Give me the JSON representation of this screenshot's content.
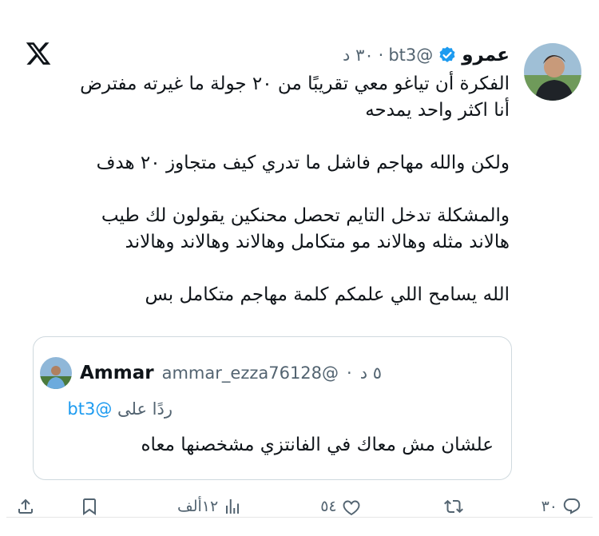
{
  "tweet": {
    "author_name": "عمرو",
    "handle": "@bt3",
    "separator": "·",
    "time": "٣٠ د",
    "lines": [
      "الفكرة أن تياغو معي تقريبًا من ٢٠ جولة ما غيرته مفترض",
      "أنا اكثر واحد يمدحه",
      "",
      "ولكن والله مهاجم فاشل ما تدري كيف متجاوز ٢٠ هدف",
      "",
      "والمشكلة تدخل التايم تحصل محنكين يقولون لك طيب",
      "هالاند مثله وهالاند مو متكامل وهالاند وهالاند وهالاند",
      "",
      "الله يسامح اللي علمكم كلمة مهاجم متكامل بس"
    ]
  },
  "quoted": {
    "name": "Ammar",
    "handle": "@ammar_ezza76128",
    "separator": "·",
    "time": "٥ د",
    "reply_prefix": "ردًا على",
    "reply_mention": "@bt3",
    "text": "علشان مش معاك في الفانتزي مشخصنها معاه"
  },
  "actions": {
    "replies": "٣٠",
    "reposts": "",
    "likes": "٥٤",
    "views": "١٢ألف"
  },
  "icons": {
    "logo": "x-logo-icon",
    "verified": "verified-badge-icon",
    "reply": "reply-icon",
    "repost": "repost-icon",
    "like": "heart-icon",
    "views": "views-icon",
    "bookmark": "bookmark-icon",
    "share": "share-icon"
  },
  "colors": {
    "text": "#0f1419",
    "secondary": "#536471",
    "accent": "#1d9bf0",
    "border": "#cfd9de"
  }
}
